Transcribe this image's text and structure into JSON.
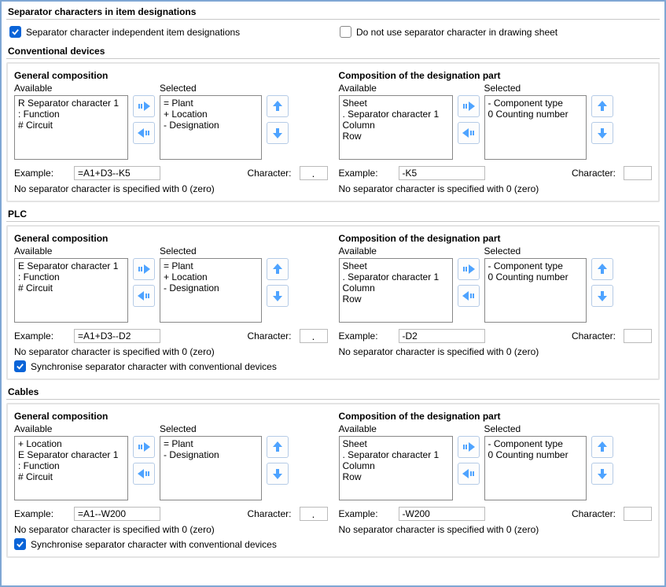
{
  "separator_section": {
    "title": "Separator characters in item designations",
    "cb_independent": "Separator character independent item designations",
    "cb_drawing": "Do not use separator character in drawing sheet"
  },
  "labels": {
    "available": "Available",
    "selected": "Selected",
    "example": "Example:",
    "character": "Character:",
    "note": "No separator character is specified with 0 (zero)",
    "sync": "Synchronise separator character with conventional devices",
    "general": "General composition",
    "designation": "Composition of the designation part"
  },
  "conventional": {
    "title": "Conventional devices",
    "gen_avail": "R Separator character 1\n: Function\n# Circuit",
    "gen_sel": "= Plant\n+ Location\n- Designation",
    "gen_example": "=A1+D3--K5",
    "gen_char": ".",
    "des_avail": "Sheet\n. Separator character 1\nColumn\nRow",
    "des_sel": "- Component type\n0 Counting number",
    "des_example": "-K5",
    "des_char": ""
  },
  "plc": {
    "title": "PLC",
    "gen_avail": "E Separator character 1\n: Function\n# Circuit",
    "gen_sel": "= Plant\n+ Location\n- Designation",
    "gen_example": "=A1+D3--D2",
    "gen_char": ".",
    "des_avail": "Sheet\n. Separator character 1\nColumn\nRow",
    "des_sel": "- Component type\n0 Counting number",
    "des_example": "-D2",
    "des_char": ""
  },
  "cables": {
    "title": "Cables",
    "gen_avail": "+ Location\nE Separator character 1\n: Function\n# Circuit",
    "gen_sel": "= Plant\n- Designation",
    "gen_example": "=A1--W200",
    "gen_char": ".",
    "des_avail": "Sheet\n. Separator character 1\nColumn\nRow",
    "des_sel": "- Component type\n0 Counting number",
    "des_example": "-W200",
    "des_char": ""
  }
}
